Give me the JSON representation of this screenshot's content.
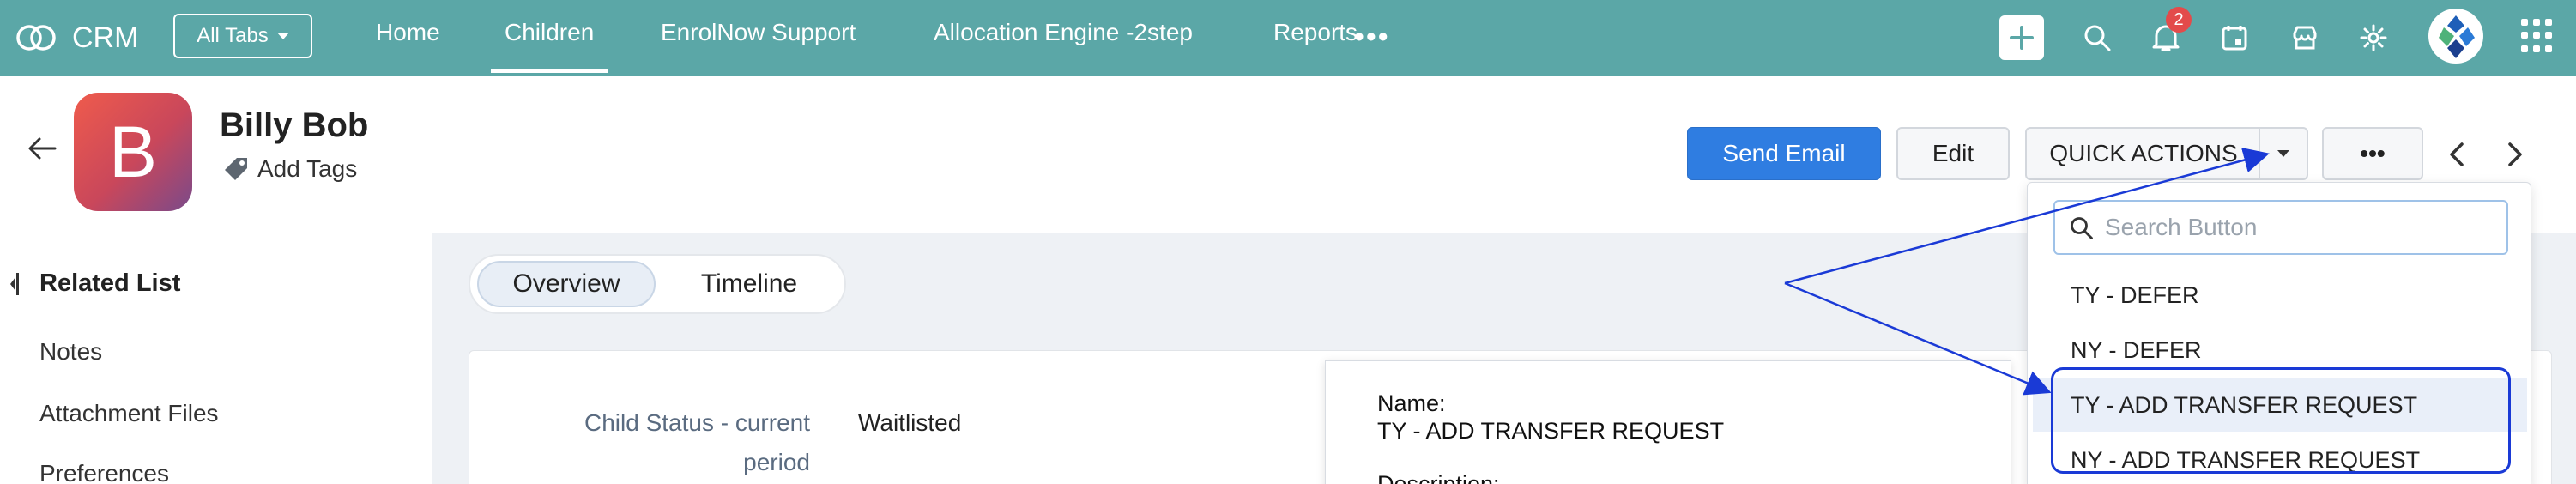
{
  "topbar": {
    "app_name": "CRM",
    "all_tabs_label": "All Tabs",
    "tabs": [
      {
        "label": "Home",
        "active": false
      },
      {
        "label": "Children",
        "active": true
      },
      {
        "label": "EnrolNow Support",
        "active": false
      },
      {
        "label": "Allocation Engine -2step",
        "active": false
      },
      {
        "label": "Reports",
        "active": false
      }
    ],
    "more_label": "•••",
    "notification_count": "2",
    "icons": [
      "plus-icon",
      "search-icon",
      "bell-icon",
      "calendar-icon",
      "store-icon",
      "gear-icon",
      "user-avatar",
      "apps-grid-icon"
    ],
    "accent_color": "#5ba7a7"
  },
  "record": {
    "avatar_letter": "B",
    "name": "Billy Bob",
    "add_tags_label": "Add Tags"
  },
  "actions": {
    "send_email_label": "Send Email",
    "edit_label": "Edit",
    "quick_actions_label": "QUICK ACTIONS",
    "more_label": "•••",
    "primary_color": "#2f7de1"
  },
  "sidebar": {
    "title": "Related List",
    "items": [
      "Notes",
      "Attachment Files",
      "Preferences"
    ]
  },
  "main": {
    "tabs": [
      "Overview",
      "Timeline"
    ],
    "field": {
      "label_line1": "Child Status - current",
      "label_line2": "period",
      "value": "Waitlisted"
    }
  },
  "tooltip": {
    "name_label": "Name:",
    "name_value": "TY - ADD TRANSFER REQUEST",
    "description_label": "Description:"
  },
  "dropdown": {
    "search_placeholder": "Search Button",
    "items": [
      "TY - DEFER",
      "NY - DEFER",
      "TY - ADD TRANSFER REQUEST",
      "NY - ADD TRANSFER REQUEST"
    ]
  }
}
